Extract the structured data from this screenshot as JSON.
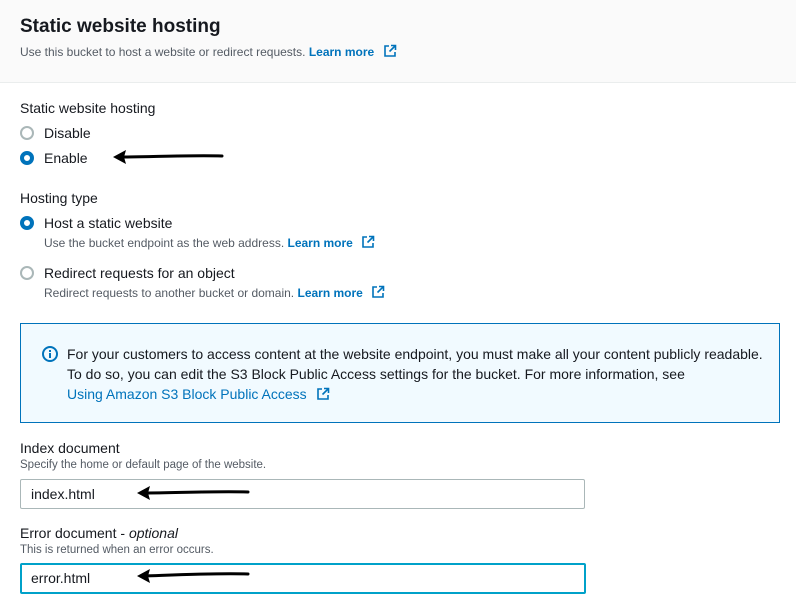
{
  "header": {
    "title": "Static website hosting",
    "subtitle": "Use this bucket to host a website or redirect requests.",
    "learn_more": "Learn more"
  },
  "hosting": {
    "label": "Static website hosting",
    "options": [
      {
        "label": "Disable",
        "selected": false
      },
      {
        "label": "Enable",
        "selected": true
      }
    ]
  },
  "hosting_type": {
    "label": "Hosting type",
    "options": [
      {
        "label": "Host a static website",
        "description": "Use the bucket endpoint as the web address.",
        "learn_more": "Learn more",
        "selected": true
      },
      {
        "label": "Redirect requests for an object",
        "description": "Redirect requests to another bucket or domain.",
        "learn_more": "Learn more",
        "selected": false
      }
    ]
  },
  "info_alert": {
    "text": "For your customers to access content at the website endpoint, you must make all your content publicly readable. To do so, you can edit the S3 Block Public Access settings for the bucket. For more information, see",
    "link": "Using Amazon S3 Block Public Access"
  },
  "index_document": {
    "label": "Index document",
    "description": "Specify the home or default page of the website.",
    "value": "index.html"
  },
  "error_document": {
    "label": "Error document -",
    "optional": "optional",
    "description": "This is returned when an error occurs.",
    "value": "error.html"
  },
  "colors": {
    "accent": "#0073bb",
    "focus": "#00a1c9",
    "alert_bg": "#f1faff",
    "text": "#16191f",
    "muted": "#545b64"
  },
  "icons": [
    "external-link-icon",
    "info-icon",
    "annotation-arrow"
  ]
}
